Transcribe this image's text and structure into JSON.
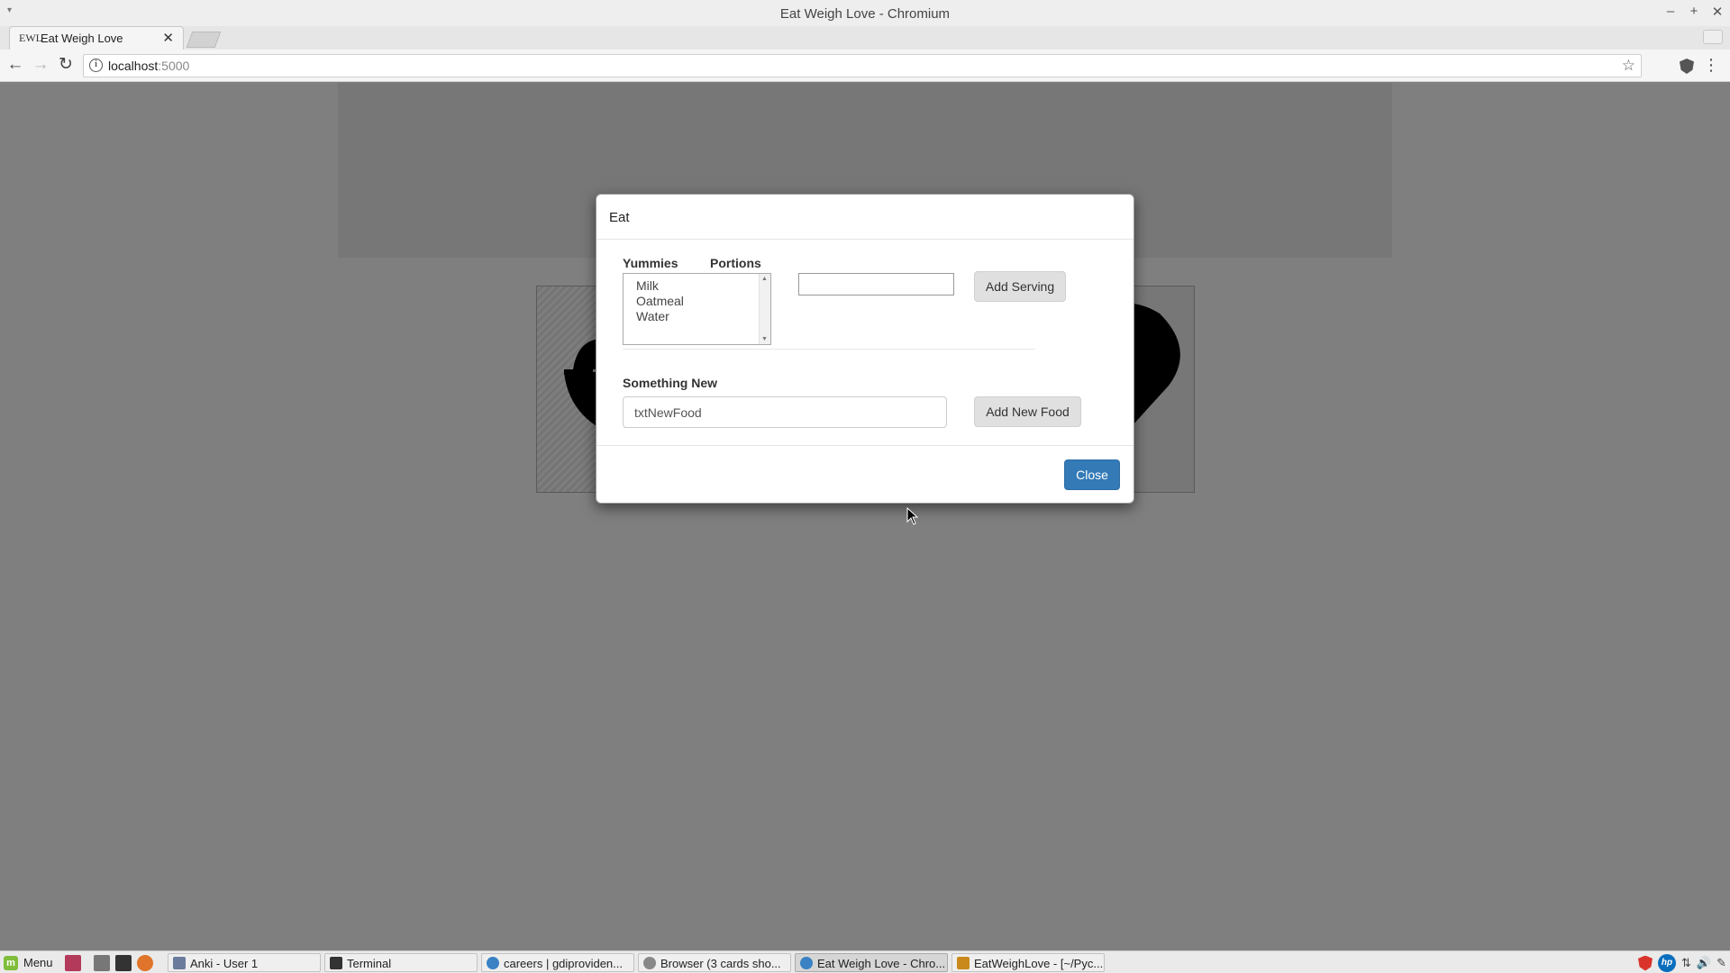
{
  "window": {
    "title": "Eat Weigh Love - Chromium",
    "menu_glyph": "▾",
    "minimize": "–",
    "maximize": "+",
    "close": "✕"
  },
  "browser": {
    "tab": {
      "favicon_text": "EWL",
      "title": "Eat Weigh Love",
      "close": "✕"
    },
    "back": "←",
    "forward": "→",
    "reload": "↻",
    "info_glyph": "i",
    "url_host": "localhost",
    "url_port": ":5000",
    "star": "☆",
    "menu": "⋮"
  },
  "modal": {
    "title": "Eat",
    "yummies_label": "Yummies",
    "portions_label": "Portions",
    "yummies_options": [
      "Milk",
      "Oatmeal",
      "Water"
    ],
    "portions_value": "",
    "add_serving_label": "Add Serving",
    "something_new_label": "Something New",
    "new_food_value": "txtNewFood",
    "add_new_food_label": "Add New Food",
    "close_label": "Close"
  },
  "tiles": [
    "eat-tile",
    "weigh-tile",
    "love-tile"
  ],
  "taskbar": {
    "menu_label": "Menu",
    "items": [
      {
        "label": "Anki - User 1",
        "icon_color": "#6b7b9b"
      },
      {
        "label": "Terminal",
        "icon_color": "#333333"
      },
      {
        "label": "careers | gdiproviden...",
        "icon_color": "#3b82c4"
      },
      {
        "label": "Browser (3 cards sho...",
        "icon_color": "#888888"
      },
      {
        "label": "Eat Weigh Love - Chro...",
        "icon_color": "#3b82c4"
      },
      {
        "label": "EatWeighLove - [~/Pyc...",
        "icon_color": "#c98a1b"
      }
    ],
    "tray_glyphs": {
      "volume": "🔊",
      "pen": "✎"
    }
  },
  "colors": {
    "primary": "#337ab7",
    "page_bg": "#7f7f7f",
    "taskbar_bg": "#eaeaea"
  }
}
